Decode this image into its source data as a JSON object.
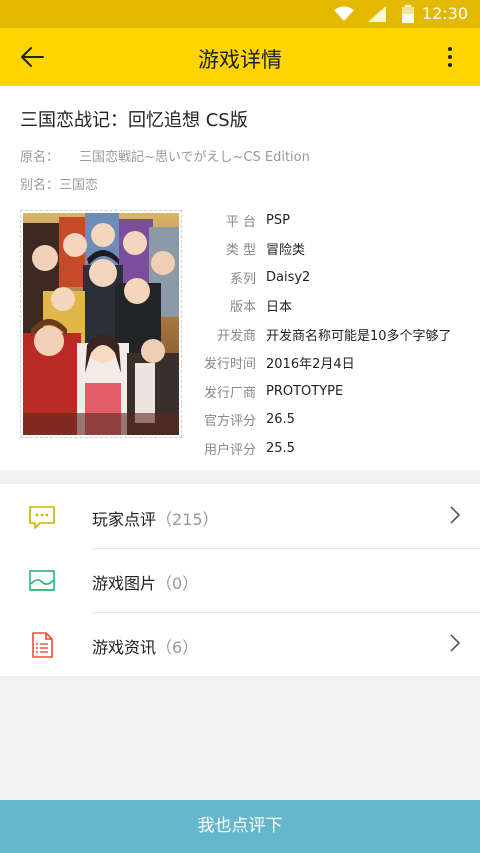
{
  "status_bar": {
    "time": "12:30",
    "icons": [
      "wifi-icon",
      "signal-icon",
      "battery-icon"
    ]
  },
  "app_bar": {
    "title": "游戏详情",
    "back_icon": "arrow-left-icon",
    "menu_icon": "more-vertical-icon"
  },
  "game": {
    "title": "三国恋战记：回忆追想 CS版",
    "original_name_label": "原名：",
    "original_name": "三国恋戦記~思いでがえし~CS Edition",
    "alias_label": "别名：",
    "alias": "三国恋"
  },
  "specs": [
    {
      "label": "平 台",
      "value": "PSP"
    },
    {
      "label": "类 型",
      "value": "冒险类"
    },
    {
      "label": "系列",
      "value": "Daisy2"
    },
    {
      "label": "版本",
      "value": "日本"
    },
    {
      "label": "开发商",
      "value": "开发商名称可能是10多个字够了"
    },
    {
      "label": "发行时间",
      "value": "2016年2月4日"
    },
    {
      "label": "发行厂商",
      "value": "PROTOTYPE"
    },
    {
      "label": "官方评分",
      "value": "26.5"
    },
    {
      "label": "用户评分",
      "value": "25.5"
    }
  ],
  "list": [
    {
      "label": "玩家点评",
      "count": "（215）",
      "icon": "comment-icon"
    },
    {
      "label": "游戏图片",
      "count": "（0）",
      "icon": "image-icon"
    },
    {
      "label": "游戏资讯",
      "count": "（6）",
      "icon": "document-icon"
    }
  ],
  "bottom_button": "我也点评下",
  "colors": {
    "status_bar": "#e3b800",
    "app_bar": "#ffd500",
    "bottom_button": "#67b7cb",
    "comment_icon": "#c8b400",
    "image_icon": "#2bb673",
    "document_icon": "#f04b3c"
  }
}
